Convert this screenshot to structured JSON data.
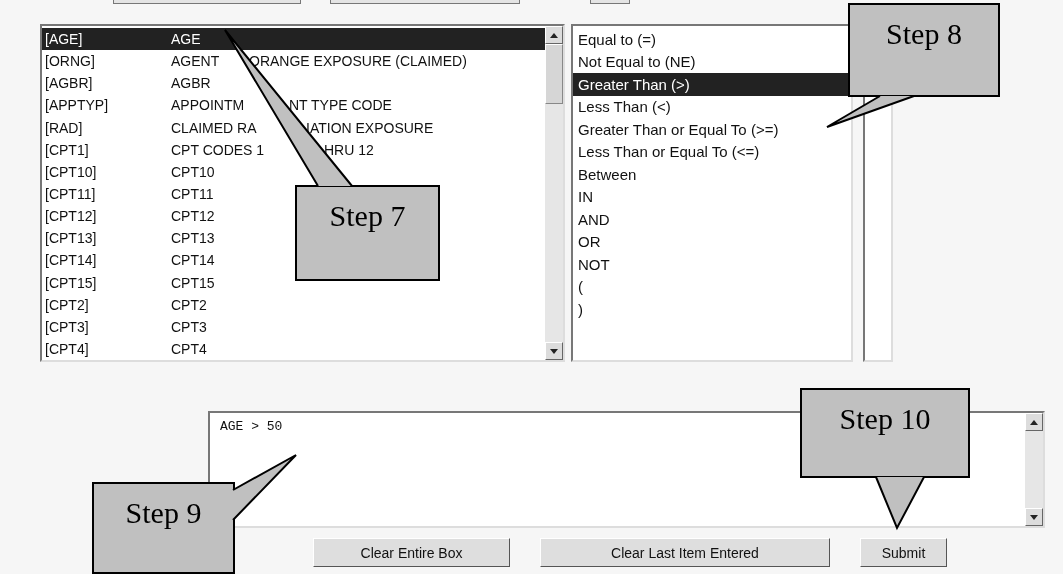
{
  "fields_list": {
    "items": [
      {
        "code": "[AGE]",
        "name": [
          "AGE"
        ],
        "selected": true
      },
      {
        "code": "[ORNG]",
        "name": [
          "AGENT",
          "ORANGE EXPOSURE (CLAIMED)"
        ],
        "selected": false
      },
      {
        "code": "[AGBR]",
        "name": [
          "AGBR"
        ],
        "selected": false
      },
      {
        "code": "[APPTYP]",
        "name": [
          "APPOINTM",
          "NT TYPE CODE"
        ],
        "selected": false
      },
      {
        "code": "[RAD]",
        "name": [
          "CLAIMED RA",
          "IATION EXPOSURE"
        ],
        "selected": false
      },
      {
        "code": "[CPT1]",
        "name": [
          "CPT CODES 1",
          "HRU 12"
        ],
        "selected": false
      },
      {
        "code": "[CPT10]",
        "name": [
          "CPT10"
        ],
        "selected": false
      },
      {
        "code": "[CPT11]",
        "name": [
          "CPT11"
        ],
        "selected": false
      },
      {
        "code": "[CPT12]",
        "name": [
          "CPT12"
        ],
        "selected": false
      },
      {
        "code": "[CPT13]",
        "name": [
          "CPT13"
        ],
        "selected": false
      },
      {
        "code": "[CPT14]",
        "name": [
          "CPT14"
        ],
        "selected": false
      },
      {
        "code": "[CPT15]",
        "name": [
          "CPT15"
        ],
        "selected": false
      },
      {
        "code": "[CPT2]",
        "name": [
          "CPT2"
        ],
        "selected": false
      },
      {
        "code": "[CPT3]",
        "name": [
          "CPT3"
        ],
        "selected": false
      },
      {
        "code": "[CPT4]",
        "name": [
          "CPT4"
        ],
        "selected": false
      }
    ]
  },
  "operators_list": {
    "items": [
      {
        "label": "Equal to (=)",
        "selected": false
      },
      {
        "label": "Not Equal to (NE)",
        "selected": false
      },
      {
        "label": "Greater Than (>)",
        "selected": true
      },
      {
        "label": "Less Than (<)",
        "selected": false
      },
      {
        "label": "Greater Than or Equal To (>=)",
        "selected": false
      },
      {
        "label": "Less Than or Equal To (<=)",
        "selected": false
      },
      {
        "label": "Between",
        "selected": false
      },
      {
        "label": "IN",
        "selected": false
      },
      {
        "label": "AND",
        "selected": false
      },
      {
        "label": "OR",
        "selected": false
      },
      {
        "label": "NOT",
        "selected": false
      },
      {
        "label": "(",
        "selected": false
      },
      {
        "label": ")",
        "selected": false
      }
    ]
  },
  "query": {
    "value": "AGE > 50"
  },
  "buttons": [
    "Clear Entire Box",
    "Clear Last Item Entered",
    "Submit"
  ],
  "callouts": [
    {
      "text": "Step 7"
    },
    {
      "text": "Step 8"
    },
    {
      "text": "Step 9"
    },
    {
      "text": "Step 10"
    }
  ]
}
